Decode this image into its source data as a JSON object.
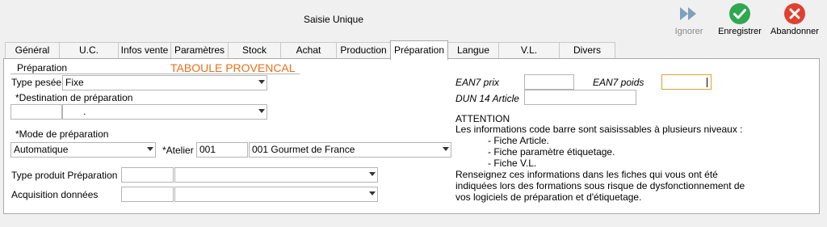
{
  "window": {
    "title": "Saisie Unique"
  },
  "toolbar": {
    "ignore_label": "Ignorer",
    "save_label": "Enregistrer",
    "cancel_label": "Abandonner",
    "colors": {
      "save": "#2fa84f",
      "cancel": "#e0412f",
      "ignore": "#8aa9c4"
    }
  },
  "tabs": [
    {
      "label": "Général"
    },
    {
      "label": "U.C."
    },
    {
      "label": "Infos vente"
    },
    {
      "label": "Paramètres"
    },
    {
      "label": "Stock"
    },
    {
      "label": "Achat"
    },
    {
      "label": "Production"
    },
    {
      "label": "Préparation"
    },
    {
      "label": "Langue"
    },
    {
      "label": "V.L."
    },
    {
      "label": "Divers"
    }
  ],
  "active_tab": "Préparation",
  "preparation": {
    "section_label": "Préparation",
    "article_name": "TABOULE PROVENCAL",
    "article_color": "#e8701a",
    "type_pesee_label": "Type pesée",
    "type_pesee_value": "Fixe",
    "destination_label": "*Destination de préparation",
    "destination_code": "",
    "destination_value": ".",
    "mode_label": "*Mode de préparation",
    "mode_value": "Automatique",
    "atelier_label": "*Atelier",
    "atelier_code": "001",
    "atelier_value": "001   Gourmet de France",
    "type_produit_label": "Type produit Préparation",
    "type_produit_code": "",
    "type_produit_value": "",
    "acquisition_label": "Acquisition données",
    "acquisition_code": "",
    "acquisition_value": ""
  },
  "barcode": {
    "ean7_prix_label": "EAN7 prix",
    "ean7_prix_value": "",
    "ean7_poids_label": "EAN7 poids",
    "ean7_poids_value": "",
    "dun14_label": "DUN 14 Article",
    "dun14_value": ""
  },
  "attention": {
    "title": "ATTENTION",
    "line1": "Les informations code barre sont saisissables à plusieurs niveaux :",
    "item1": "- Fiche Article.",
    "item2": "- Fiche paramètre étiquetage.",
    "item3": "- Fiche V.L.",
    "line2": "Renseignez ces informations dans les fiches qui vous ont été",
    "line3": "indiquées lors des formations sous risque de dysfonctionnement de",
    "line4": "vos logiciels de préparation et d'étiquetage."
  }
}
